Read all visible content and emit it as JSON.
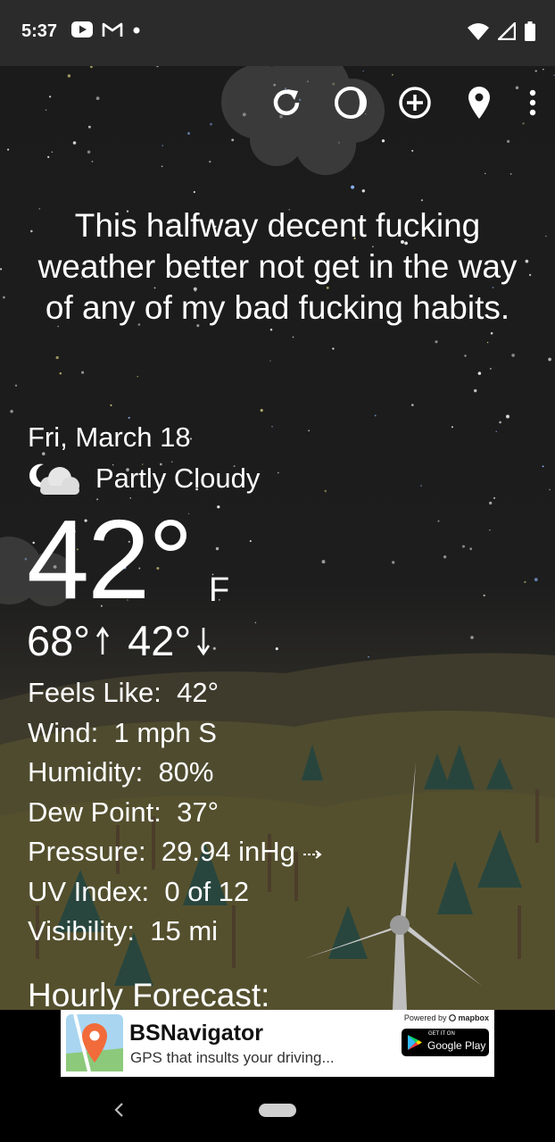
{
  "status_bar": {
    "time": "5:37",
    "icons": [
      "youtube-icon",
      "gmail-icon",
      "dot-icon",
      "wifi-icon",
      "signal-icon",
      "battery-icon"
    ]
  },
  "toolbar": {
    "icons": [
      "refresh-icon",
      "theme-icon",
      "add-location-icon",
      "location-pin-icon",
      "more-vert-icon"
    ]
  },
  "quote": "This halfway decent fucking weather better not get in the way of any of my bad fucking habits.",
  "weather": {
    "date": "Fri, March 18",
    "condition": "Partly Cloudy",
    "temperature": "42°",
    "unit": "F",
    "high": "68°",
    "low": "42°",
    "details": [
      {
        "label": "Feels Like:",
        "value": "42°"
      },
      {
        "label": "Wind:",
        "value": "1 mph S"
      },
      {
        "label": "Humidity:",
        "value": "80%"
      },
      {
        "label": "Dew Point:",
        "value": "37°"
      },
      {
        "label": "Pressure:",
        "value": "29.94 inHg"
      },
      {
        "label": "UV Index:",
        "value": "0 of 12"
      },
      {
        "label": "Visibility:",
        "value": "15 mi"
      }
    ],
    "hourly_heading": "Hourly Forecast:"
  },
  "ad": {
    "title": "BSNavigator",
    "subtitle": "GPS that insults your driving...",
    "powered_by": "Powered by",
    "powered_brand": "mapbox",
    "play_top": "GET IT ON",
    "play_bottom": "Google Play"
  },
  "colors": {
    "status_bar": "#2b2b2b",
    "sky": "#1b1b1b",
    "hills": "#4d4a2f",
    "text": "#ffffff"
  }
}
